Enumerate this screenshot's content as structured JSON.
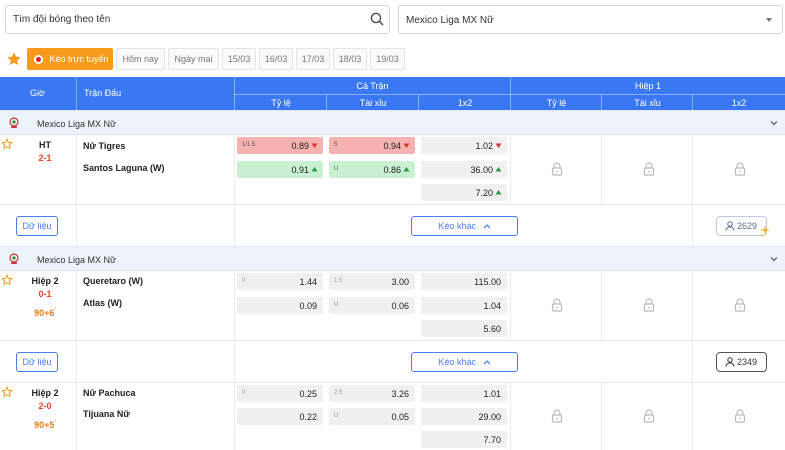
{
  "search": {
    "placeholder": "Tìm đội bóng theo tên"
  },
  "league_filter": {
    "selected": "Mexico Liga MX Nữ"
  },
  "filters": {
    "live": "Kèo trực tuyến",
    "days": [
      "Hôm nay",
      "Ngày mai",
      "15/03",
      "16/03",
      "17/03",
      "18/03",
      "19/03"
    ]
  },
  "table_header": {
    "time": "Giờ",
    "match": "Trận Đấu",
    "full_match": "Cả Trận",
    "half1": "Hiệp 1",
    "handicap": "Tỷ lệ",
    "overunder": "Tài xỉu",
    "onextwo": "1x2"
  },
  "matches": [
    {
      "league": "Mexico Liga MX Nữ",
      "status": "HT",
      "score": "2-1",
      "minute": "",
      "added": "",
      "home": "Nữ Tigres",
      "away": "Santos Laguna (W)",
      "hdp": {
        "home_line": "1/1.5",
        "home": "0.89",
        "away_line": "",
        "away": "0.91"
      },
      "ou": {
        "over_line": "5",
        "over": "0.94",
        "under_line": "U",
        "under": "0.86"
      },
      "x12": [
        "1.02",
        "36.00",
        "7.20"
      ],
      "data_btn": "Dữ liệu",
      "more_btn": "Kèo khác",
      "viewers": "2629"
    },
    {
      "league": "Mexico Liga MX Nữ",
      "status": "Hiệp 2",
      "score": "0-1",
      "minute": "90+6",
      "added": "'",
      "home": "Queretaro (W)",
      "away": "Atlas (W)",
      "hdp": {
        "home_line": "0",
        "home": "1.44",
        "away_line": "",
        "away": "0.09"
      },
      "ou": {
        "over_line": "1.5",
        "over": "3.00",
        "under_line": "U",
        "under": "0.06"
      },
      "x12": [
        "115.00",
        "1.04",
        "5.60"
      ],
      "data_btn": "Dữ liệu",
      "more_btn": "Kèo khác",
      "viewers": "2349"
    },
    {
      "league": "",
      "status": "Hiệp 2",
      "score": "2-0",
      "minute": "90+5",
      "added": "'",
      "home": "Nữ Pachuca",
      "away": "Tijuana Nữ",
      "hdp": {
        "home_line": "0",
        "home": "0.25",
        "away_line": "",
        "away": "0.22"
      },
      "ou": {
        "over_line": "2.5",
        "over": "3.26",
        "under_line": "U",
        "under": "0.05"
      },
      "x12": [
        "1.01",
        "29.00",
        "7.70"
      ]
    }
  ],
  "colors": {
    "accent": "#3a77f2",
    "live": "#f89a1c",
    "odds_down": "#f6b1b1",
    "odds_up": "#c9f0d2",
    "score": "#e8452c"
  }
}
